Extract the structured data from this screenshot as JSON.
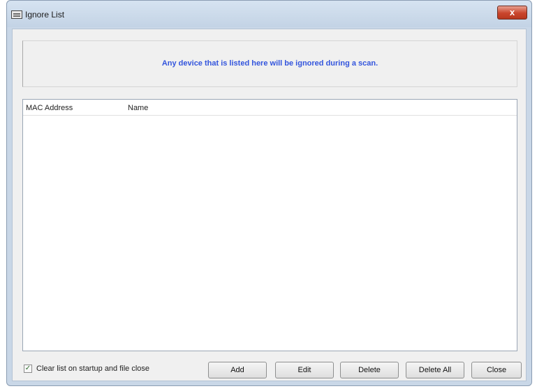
{
  "window": {
    "title": "Ignore List",
    "close_glyph": "x"
  },
  "info": {
    "text": "Any device that is listed here will be ignored during a scan."
  },
  "list": {
    "columns": [
      "MAC Address",
      "Name"
    ],
    "rows": []
  },
  "footer": {
    "checkbox_label": "Clear list on startup and file close",
    "checkbox_checked": true,
    "checkbox_glyph": "✓",
    "buttons": [
      "Add",
      "Edit",
      "Delete",
      "Delete All",
      "Close"
    ]
  },
  "colors": {
    "info_text": "#3355dd",
    "close_button": "#c9452c"
  },
  "icons": {
    "title": "window-list-icon",
    "close": "close-icon"
  }
}
